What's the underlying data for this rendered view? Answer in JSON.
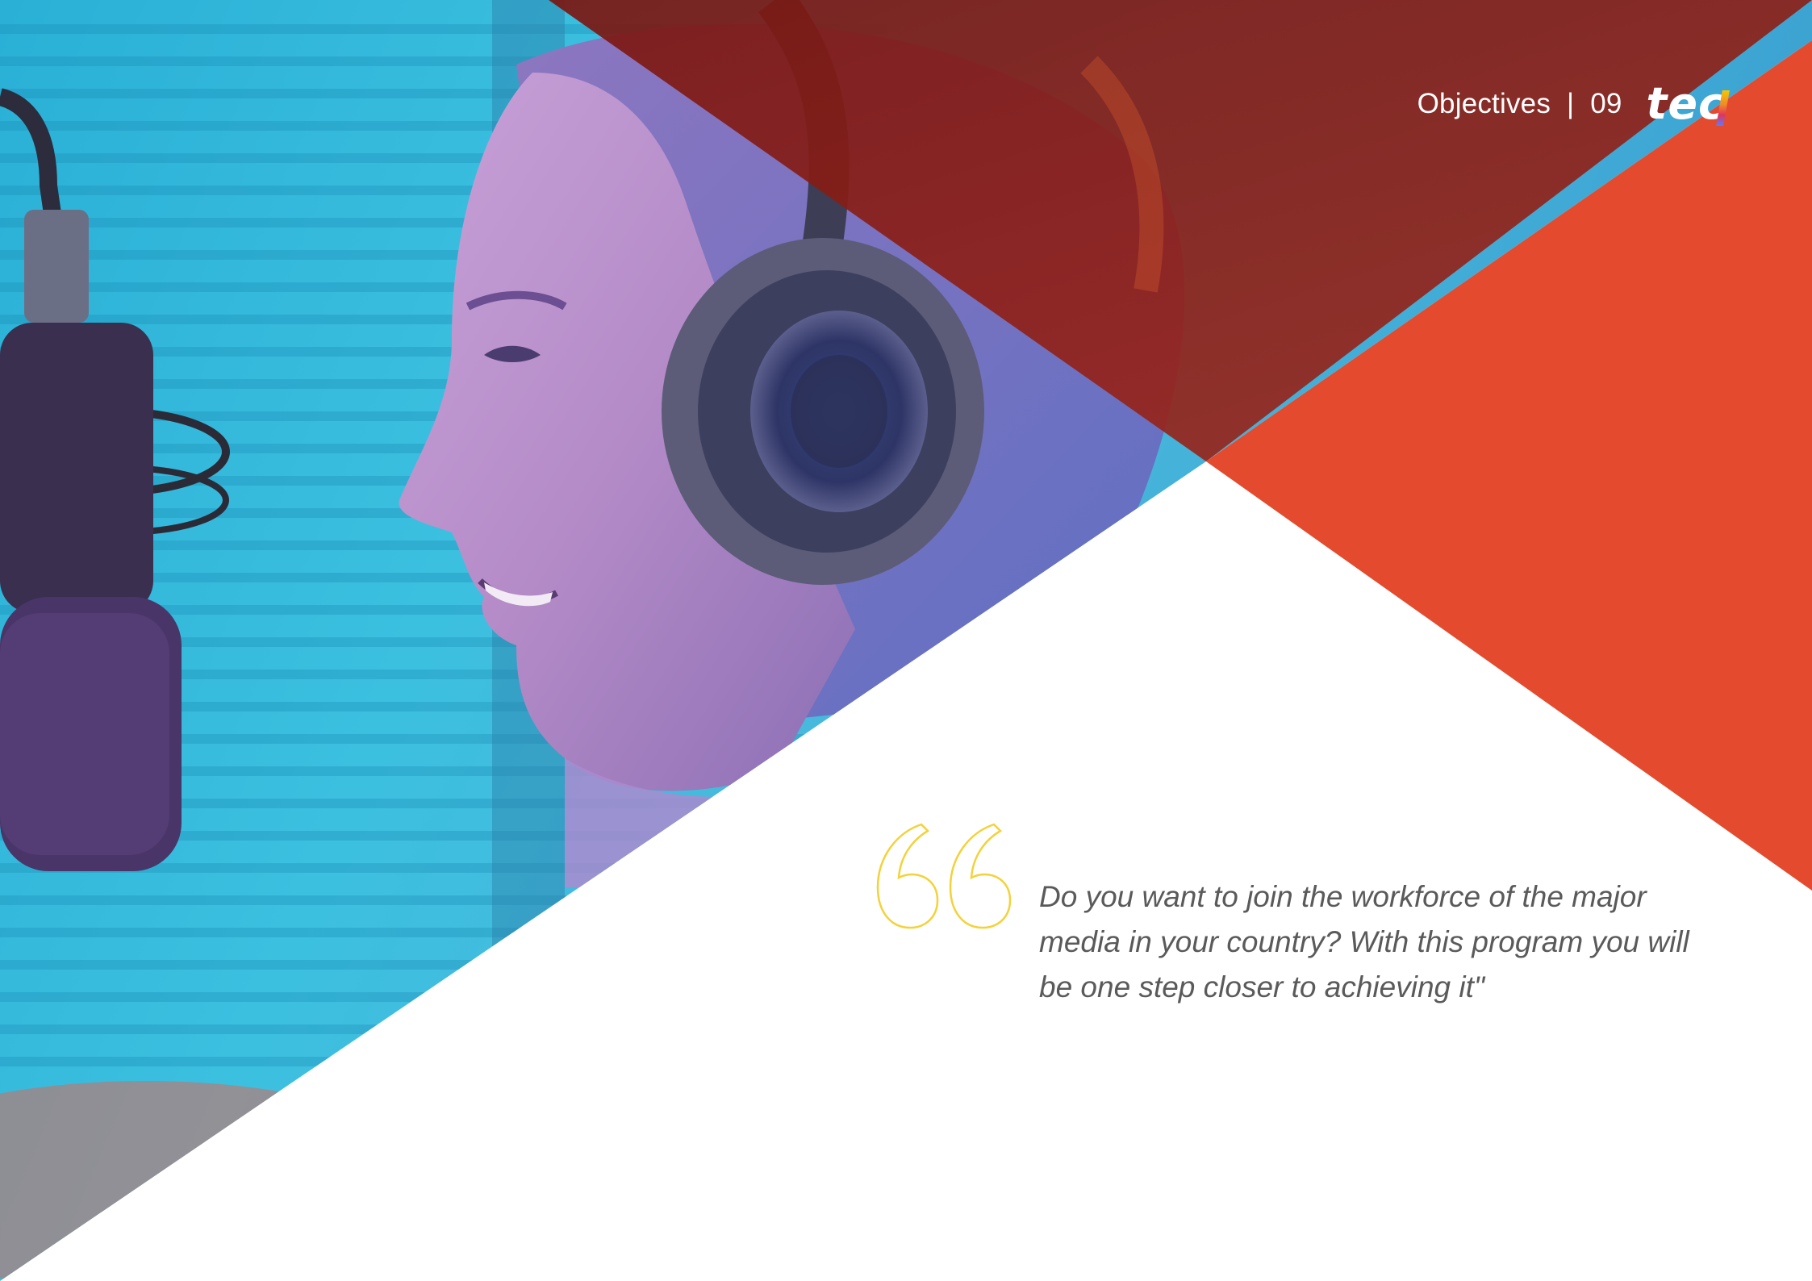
{
  "header": {
    "section": "Objectives",
    "separator": "|",
    "page_number": "09",
    "logo_text": "tec"
  },
  "quote": {
    "text": "Do you want to join the workforce of the major media in your country? With this program you will be one step closer to achieving it\""
  },
  "colors": {
    "accent_red": "#e34a2e",
    "quote_mark": "#f3d23a",
    "photo_cyan": "#3fb8d8",
    "photo_purple": "#6a4b8f"
  },
  "icons": {
    "quote": "opening-quote-icon",
    "photo": "radio-host-with-headphones-and-microphone"
  }
}
